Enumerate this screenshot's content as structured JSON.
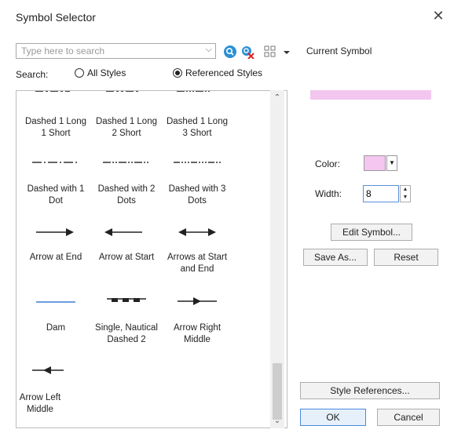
{
  "dialog": {
    "title": "Symbol Selector",
    "close_glyph": "✕"
  },
  "search": {
    "placeholder": "Type here to search",
    "label": "Search:",
    "options": [
      "All Styles",
      "Referenced Styles"
    ],
    "selected": "Referenced Styles"
  },
  "toolbar_icons": [
    "search-icon",
    "clear-search-icon",
    "view-options-icon"
  ],
  "gallery": {
    "items": [
      {
        "label_lines": [
          "Dashed 1 Long",
          "1 Short"
        ]
      },
      {
        "label_lines": [
          "Dashed 1 Long",
          "2 Short"
        ]
      },
      {
        "label_lines": [
          "Dashed 1 Long",
          "3 Short"
        ]
      },
      {
        "label_lines": [
          "Dashed with 1",
          "Dot"
        ]
      },
      {
        "label_lines": [
          "Dashed with 2",
          "Dots"
        ]
      },
      {
        "label_lines": [
          "Dashed with 3",
          "Dots"
        ]
      },
      {
        "label_lines": [
          "Arrow at End",
          ""
        ]
      },
      {
        "label_lines": [
          "Arrow at Start",
          ""
        ]
      },
      {
        "label_lines": [
          "Arrows at Start",
          "and End"
        ]
      },
      {
        "label_lines": [
          "Dam",
          ""
        ]
      },
      {
        "label_lines": [
          "Single, Nautical",
          "Dashed 2"
        ]
      },
      {
        "label_lines": [
          "Arrow Right",
          "Middle"
        ]
      },
      {
        "label_lines": [
          "Arrow Left",
          "Middle"
        ]
      }
    ]
  },
  "current_symbol": {
    "label": "Current Symbol",
    "color_label": "Color:",
    "color_value": "#f4c6f0",
    "width_label": "Width:",
    "width_value": "8",
    "edit_button": "Edit Symbol...",
    "save_as_button": "Save As...",
    "reset_button": "Reset"
  },
  "footer": {
    "style_references_button": "Style References...",
    "ok_button": "OK",
    "cancel_button": "Cancel"
  },
  "colors": {
    "preview": "#f2c6ef",
    "dam_line": "#3a7fd5",
    "accent": "#4a89dc"
  }
}
